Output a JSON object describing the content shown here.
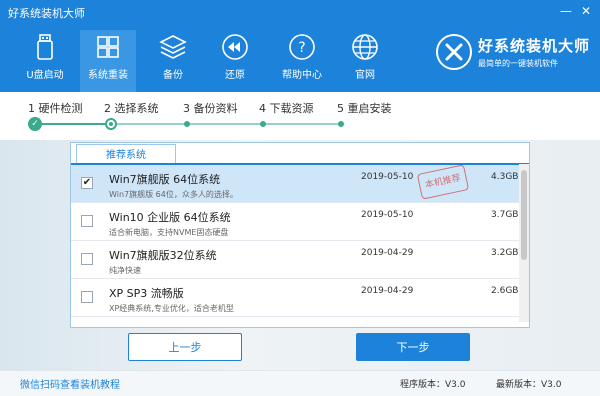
{
  "window": {
    "title": "好系统装机大师",
    "minimize_glyph": "—",
    "close_glyph": "✕"
  },
  "nav": [
    {
      "label": "U盘启动",
      "icon": "usb-drive-icon"
    },
    {
      "label": "系统重装",
      "icon": "windows-grid-icon",
      "active": true
    },
    {
      "label": "备份",
      "icon": "layers-icon"
    },
    {
      "label": "还原",
      "icon": "rewind-icon"
    },
    {
      "label": "帮助中心",
      "icon": "question-icon"
    },
    {
      "label": "官网",
      "icon": "globe-icon"
    }
  ],
  "brand": {
    "name": "好系统装机大师",
    "slogan": "最简单的一键装机软件"
  },
  "steps": [
    {
      "label": "1 硬件检测",
      "state": "done"
    },
    {
      "label": "2 选择系统",
      "state": "current"
    },
    {
      "label": "3 备份资料",
      "state": "pending"
    },
    {
      "label": "4 下载资源",
      "state": "pending"
    },
    {
      "label": "5 重启安装",
      "state": "pending"
    }
  ],
  "tab": {
    "label": "推荐系统"
  },
  "systems": [
    {
      "name": "Win7旗舰版 64位系统",
      "desc": "Win7旗舰版 64位，众多人的选择。",
      "date": "2019-05-10",
      "size": "4.3GB",
      "checked": true,
      "stamp": "本机推荐"
    },
    {
      "name": "Win10 企业版 64位系统",
      "desc": "适合新电脑，支持NVME固态硬盘",
      "date": "2019-05-10",
      "size": "3.7GB",
      "checked": false
    },
    {
      "name": "Win7旗舰版32位系统",
      "desc": "纯净快速",
      "date": "2019-04-29",
      "size": "3.2GB",
      "checked": false
    },
    {
      "name": "XP SP3 流畅版",
      "desc": "XP经典系统,专业优化，适合老机型",
      "date": "2019-04-29",
      "size": "2.6GB",
      "checked": false
    }
  ],
  "buttons": {
    "prev": "上一步",
    "next": "下一步"
  },
  "footer": {
    "tutorial_link": "微信扫码查看装机教程",
    "program_version": "程序版本：V3.0",
    "latest_version": "最新版本：V3.0"
  },
  "colors": {
    "primary": "#1c82da",
    "step_green": "#3aa98c",
    "selected_row": "#cfe6f8"
  }
}
